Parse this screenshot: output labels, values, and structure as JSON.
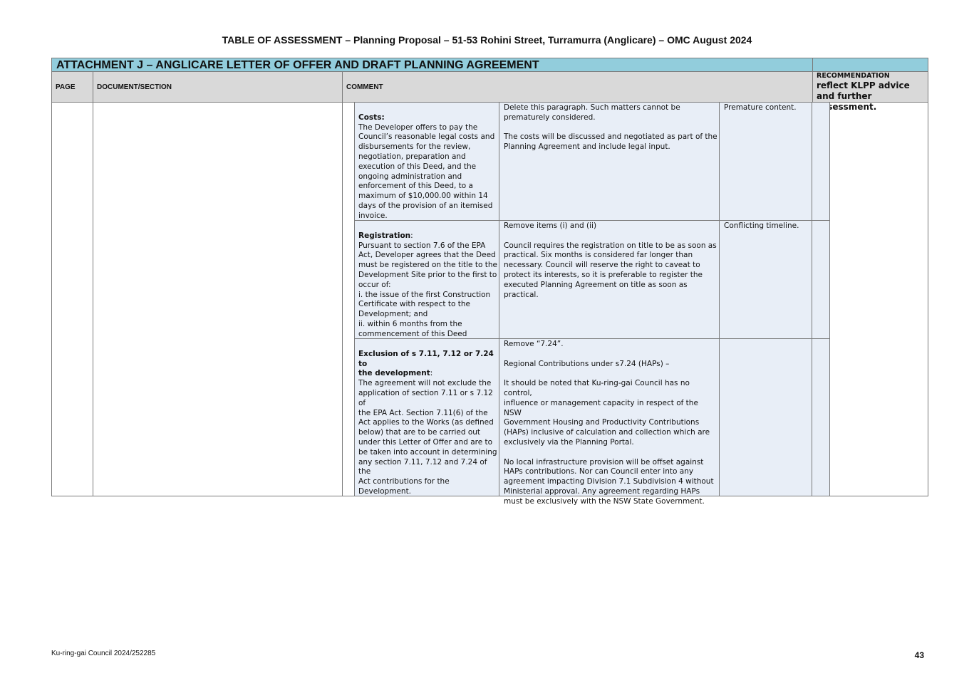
{
  "document": {
    "title": "TABLE OF ASSESSMENT – Planning Proposal – 51-53 Rohini Street, Turramurra (Anglicare) – OMC August 2024",
    "attachment_heading": "ATTACHMENT J – ANGLICARE LETTER OF OFFER AND DRAFT PLANNING AGREEMENT",
    "columns": {
      "page": "PAGE",
      "document_section": "DOCUMENT/SECTION",
      "comment": "COMMENT",
      "recommendation": "RECOMMENDATION",
      "recommendation_text": "reflect KLPP advice and further assessment."
    },
    "rows": [
      {
        "heading": "Costs:",
        "body": "The Developer offers to pay the\nCouncil’s reasonable legal costs and\ndisbursements for the review,\nnegotiation, preparation and\nexecution of this Deed, and the\nongoing administration and\nenforcement of this Deed, to a\nmaximum of $10,000.00 within 14\ndays of the provision of an itemised\ninvoice.",
        "comment": "Delete this paragraph. Such matters cannot be\nprematurely considered.\n\nThe costs will be discussed and negotiated as part of the\nPlanning Agreement and include legal input.",
        "reason": "Premature content."
      },
      {
        "heading": "Registration",
        "heading_suffix": ":",
        "body": "Pursuant to section 7.6 of the EPA\nAct, Developer agrees that the Deed\nmust be registered on the title to the\nDevelopment Site prior to the first to\noccur of:\ni. the issue of the first Construction\n   Certificate with respect to the\n   Development; and\nii. within 6 months from the\n   commencement of this Deed",
        "comment": "Remove items (i) and (ii)\n\nCouncil requires the registration on title to be as soon as\npractical. Six months is considered far longer than\nnecessary. Council will reserve the right to caveat to\nprotect its interests, so it is preferable to register the\nexecuted Planning Agreement on title as soon as\npractical.",
        "reason": "Conflicting timeline."
      },
      {
        "heading": "Exclusion of s 7.11, 7.12 or 7.24 to\nthe development",
        "heading_suffix": ":",
        "body": "The agreement will not exclude the\napplication of section 7.11 or s 7.12 of\nthe EPA Act. Section 7.11(6) of the\nAct applies to the Works (as defined\nbelow) that are to be carried out\nunder this Letter of Offer and are to\nbe taken into account in determining\nany section 7.11, 7.12 and 7.24 of the\nAct contributions for the\nDevelopment.",
        "comment": "Remove “7.24”.\n\nRegional Contributions under s7.24 (HAPs) –\n\nIt should be noted that Ku-ring-gai Council has no control,\ninfluence or management capacity in respect of the NSW\nGovernment Housing and Productivity Contributions\n(HAPs) inclusive of calculation and collection which are\nexclusively via the Planning Portal.\n\nNo local infrastructure provision will be offset against\nHAPs contributions. Nor can Council enter into any\nagreement impacting Division 7.1 Subdivision 4 without\nMinisterial approval. Any agreement regarding HAPs\nmust be exclusively with the NSW State Government.",
        "reason": ""
      }
    ],
    "footer": {
      "reference": "Ku-ring-gai Council 2024/252285",
      "page_number": "43"
    }
  }
}
